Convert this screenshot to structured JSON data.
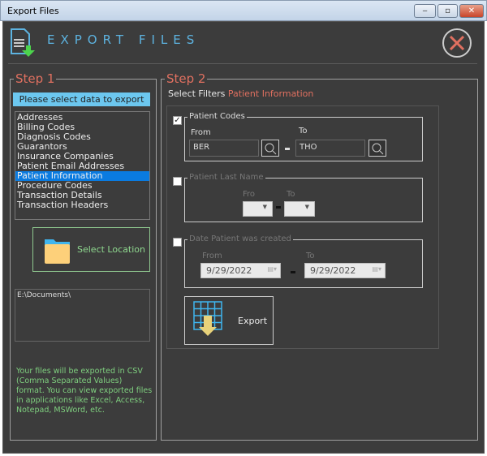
{
  "window": {
    "title": "Export Files",
    "buttons": [
      "minimize",
      "maximize",
      "close"
    ]
  },
  "header": {
    "title": "EXPORT FILES",
    "icon": "export-file-icon",
    "close_icon": "close-circle-icon",
    "accent": "#5db3e0"
  },
  "step1": {
    "legend": "Step 1",
    "prompt": "Please select data to export",
    "items": [
      "Addresses",
      "Billing Codes",
      "Diagnosis Codes",
      "Guarantors",
      "Insurance Companies",
      "Patient Email Addresses",
      "Patient Information",
      "Procedure Codes",
      "Transaction Details",
      "Transaction Headers"
    ],
    "selected": "Patient Information",
    "select_location": "Select Location",
    "path": "E:\\Documents\\",
    "info": "Your files will be exported in CSV (Comma Separated Values) format. You can view exported files in applications like Excel, Access, Notepad, MSWord, etc."
  },
  "step2": {
    "legend": "Step 2",
    "select_filters": "Select Filters",
    "selected_table": "Patient Information",
    "patient_codes": {
      "label": "Patient Codes",
      "checked": true,
      "from_label": "From",
      "to_label": "To",
      "from": "BER",
      "to": "THO"
    },
    "last_name": {
      "label": "Patient Last Name",
      "checked": false,
      "from_label": "Fro",
      "to_label": "To"
    },
    "date_created": {
      "label": "Date Patient was created",
      "checked": false,
      "from_label": "From",
      "to_label": "To",
      "from": "9/29/2022",
      "to": "9/29/2022"
    },
    "export": "Export"
  }
}
